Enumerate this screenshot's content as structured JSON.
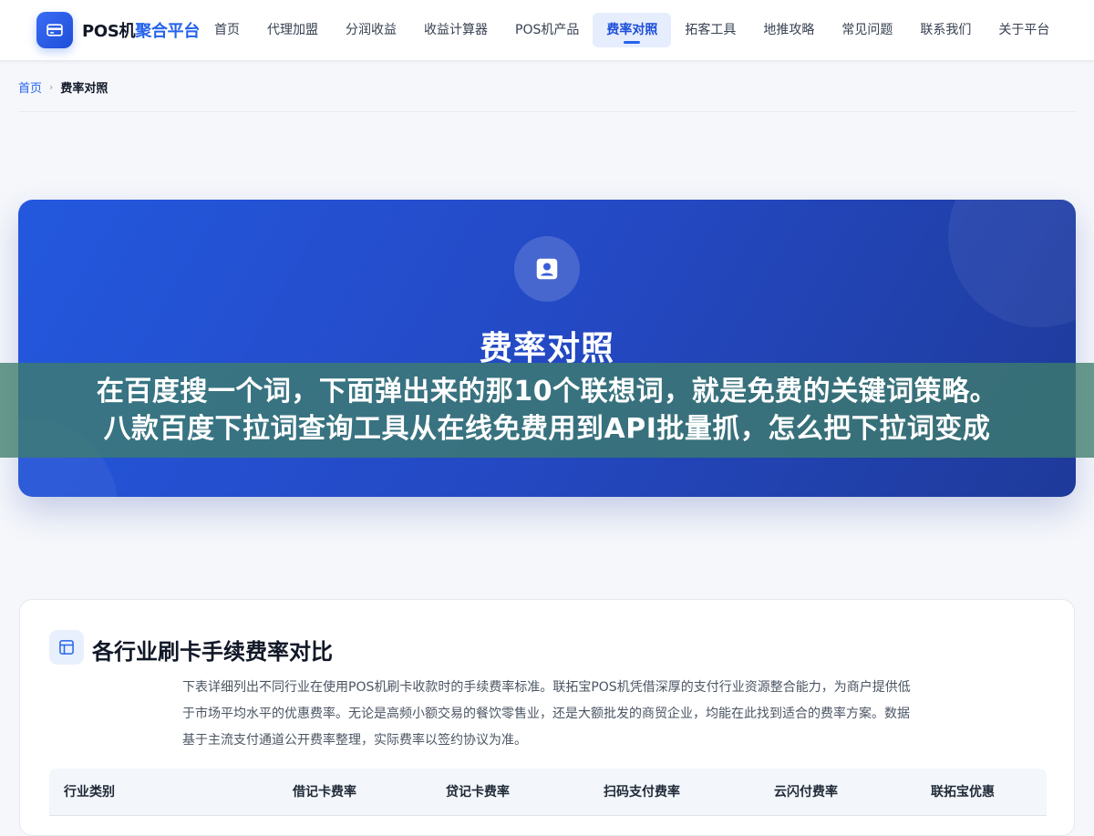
{
  "brand": {
    "name_part1": "POS机",
    "name_part2": "聚合平台",
    "accent_color": "#2563eb",
    "icon": "credit-card-icon"
  },
  "nav": {
    "items": [
      {
        "label": "首页",
        "active": false
      },
      {
        "label": "代理加盟",
        "active": false
      },
      {
        "label": "分润收益",
        "active": false
      },
      {
        "label": "收益计算器",
        "active": false
      },
      {
        "label": "POS机产品",
        "active": false
      },
      {
        "label": "费率对照",
        "active": true
      },
      {
        "label": "拓客工具",
        "active": false
      },
      {
        "label": "地推攻略",
        "active": false
      },
      {
        "label": "常见问题",
        "active": false
      },
      {
        "label": "联系我们",
        "active": false
      },
      {
        "label": "关于平台",
        "active": false
      }
    ]
  },
  "breadcrumb": {
    "home": "首页",
    "separator": "›",
    "current": "费率对照"
  },
  "hero": {
    "icon": "id-badge-icon",
    "title": "费率对照"
  },
  "overlay": {
    "line1": "在百度搜一个词，下面弹出来的那10个联想词，就是免费的关键词策略。",
    "line2": "八款百度下拉词查询工具从在线免费用到API批量抓，怎么把下拉词变成"
  },
  "section": {
    "icon": "table-icon",
    "title": "各行业刷卡手续费率对比",
    "description": "下表详细列出不同行业在使用POS机刷卡收款时的手续费率标准。联拓宝POS机凭借深厚的支付行业资源整合能力，为商户提供低于市场平均水平的优惠费率。无论是高频小额交易的餐饮零售业，还是大额批发的商贸企业，均能在此找到适合的费率方案。数据基于主流支付通道公开费率整理，实际费率以签约协议为准。",
    "table": {
      "columns": [
        "行业类别",
        "借记卡费率",
        "贷记卡费率",
        "扫码支付费率",
        "云闪付费率",
        "联拓宝优惠"
      ]
    }
  }
}
